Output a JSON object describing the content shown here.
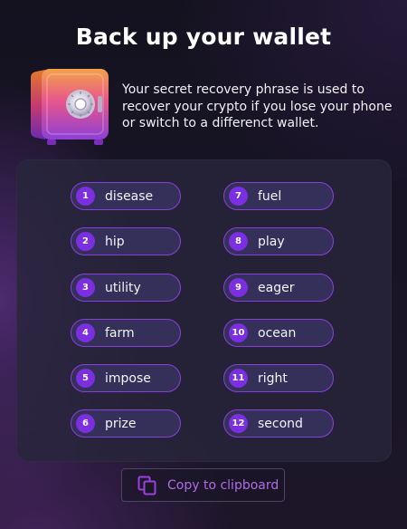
{
  "header": {
    "title": "Back up your wallet",
    "description": "Your secret recovery phrase is used to recover your crypto if you lose your phone or switch to a differenct wallet."
  },
  "illustration": {
    "icon": "safe-icon"
  },
  "phrase": {
    "words": [
      {
        "number": "1",
        "word": "disease"
      },
      {
        "number": "2",
        "word": "hip"
      },
      {
        "number": "3",
        "word": "utility"
      },
      {
        "number": "4",
        "word": "farm"
      },
      {
        "number": "5",
        "word": "impose"
      },
      {
        "number": "6",
        "word": "prize"
      },
      {
        "number": "7",
        "word": "fuel"
      },
      {
        "number": "8",
        "word": "play"
      },
      {
        "number": "9",
        "word": "eager"
      },
      {
        "number": "10",
        "word": "ocean"
      },
      {
        "number": "11",
        "word": "right"
      },
      {
        "number": "12",
        "word": "second"
      }
    ]
  },
  "actions": {
    "copy_label": "Copy to clipboard",
    "copy_icon": "copy-icon"
  },
  "colors": {
    "accent": "#7b2fe0",
    "accent_text": "#b26be8",
    "pill_border": "#8a3fdc"
  }
}
